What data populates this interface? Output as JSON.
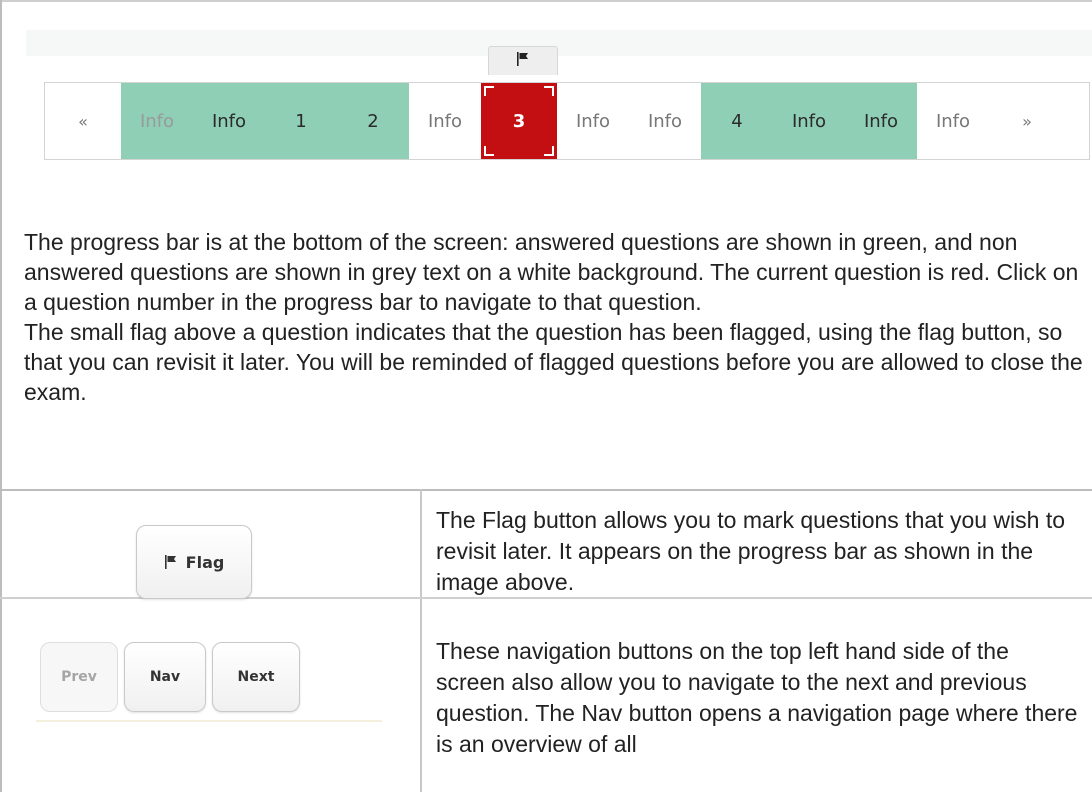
{
  "progress_bar": {
    "flag_icon": "flag-icon",
    "cells": [
      {
        "label": "«",
        "state": "arrow"
      },
      {
        "label": "Info",
        "state": "answered-faded"
      },
      {
        "label": "Info",
        "state": "answered"
      },
      {
        "label": "1",
        "state": "answered"
      },
      {
        "label": "2",
        "state": "answered"
      },
      {
        "label": "Info",
        "state": "unanswered"
      },
      {
        "label": "3",
        "state": "current"
      },
      {
        "label": "Info",
        "state": "unanswered"
      },
      {
        "label": "Info",
        "state": "unanswered"
      },
      {
        "label": "4",
        "state": "answered"
      },
      {
        "label": "Info",
        "state": "answered"
      },
      {
        "label": "Info",
        "state": "answered"
      },
      {
        "label": "Info",
        "state": "unanswered"
      },
      {
        "label": "»",
        "state": "arrow"
      }
    ]
  },
  "description": {
    "paragraph1": "The progress bar is at the bottom of the screen: answered questions are shown in green, and non answered questions are shown in grey text on a white background. The current question is red. Click on a question number in the progress bar to navigate to that question.",
    "paragraph2": "The small flag above a question indicates that the question has been flagged, using the flag button, so that you can revisit it later. You will be reminded of flagged questions before you are allowed to close the exam."
  },
  "table": {
    "row1": {
      "button_label": "Flag",
      "text": "The Flag button allows you to mark questions that you wish to revisit later. It appears on the progress bar as shown in the image above."
    },
    "row2": {
      "prev_label": "Prev",
      "nav_label": "Nav",
      "next_label": "Next",
      "text": "These navigation buttons on the top left hand side of the screen also allow you to navigate to the next and previous question. The Nav button opens a navigation page where there is an overview of all"
    }
  },
  "colors": {
    "answered": "#8fcfb5",
    "current": "#c30f12",
    "unanswered_bg": "#ffffff"
  }
}
